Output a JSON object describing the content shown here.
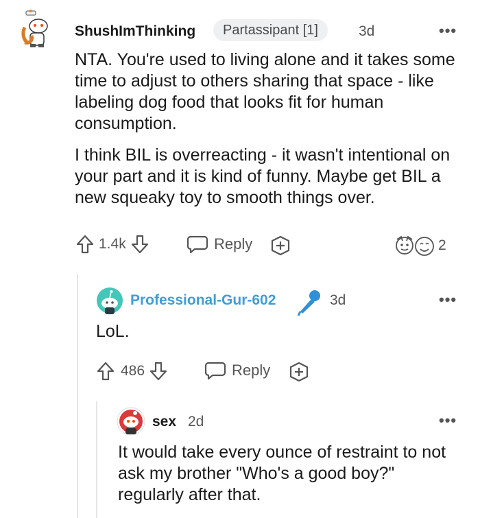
{
  "comments": [
    {
      "username": "ShushImThinking",
      "flair": "Partassipant [1]",
      "time": "3d",
      "more": "•••",
      "paragraphs": [
        "NTA. You're used to living alone and it takes some time to adjust to others sharing that space - like labeling dog food that looks fit for human consumption.",
        "I think BIL is overreacting - it wasn't intentional on your part and it is kind of funny. Maybe get BIL a new squeaky toy to smooth things over."
      ],
      "votes": "1.4k",
      "reply_label": "Reply",
      "award_count": "2"
    },
    {
      "username": "Professional-Gur-602",
      "time": "3d",
      "more": "•••",
      "text": "LoL.",
      "votes": "486",
      "reply_label": "Reply"
    },
    {
      "username": "sex",
      "time": "2d",
      "more": "•••",
      "text": "It would take every ounce of restraint to not ask my brother \"Who's a good boy?\" regularly after that."
    }
  ],
  "colors": {
    "op_username": "#1a1a1b",
    "reply_username": "#3e9ed8",
    "meta": "#555555",
    "mic": "#2f8fd9"
  }
}
